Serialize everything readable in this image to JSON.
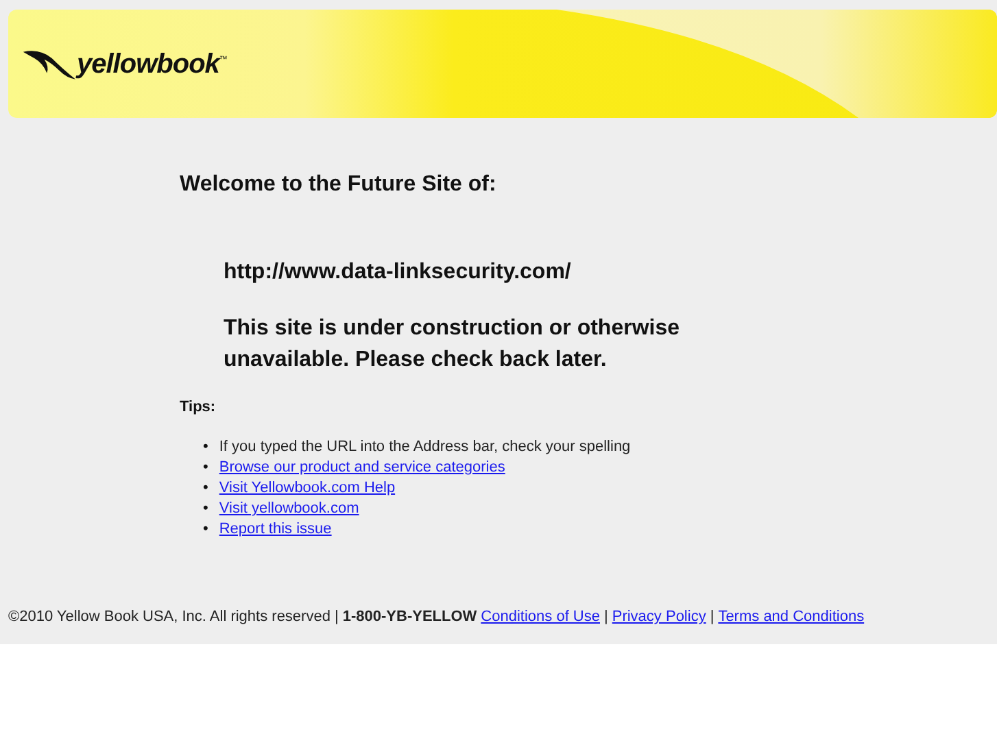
{
  "banner": {
    "logo_text": "yellowbook",
    "logo_mark": "™"
  },
  "heading": "Welcome to the Future Site of:",
  "url": "http://www.data-linksecurity.com/",
  "message": "This site is under construction or otherwise unavailable. Please check back later.",
  "tips": {
    "title": "Tips:",
    "items": [
      {
        "kind": "text",
        "marker": "•",
        "text": "If you typed the URL into the Address bar, check your spelling"
      },
      {
        "kind": "link",
        "marker": "•",
        "text": "Browse our product and service categories"
      },
      {
        "kind": "link",
        "marker": "•",
        "text": "Visit Yellowbook.com Help"
      },
      {
        "kind": "link",
        "marker": "•",
        "text": "Visit yellowbook.com"
      },
      {
        "kind": "link",
        "marker": "•",
        "text": "Report this issue"
      }
    ]
  },
  "footer": [
    {
      "kind": "text",
      "text": "©2010 Yellow Book USA, Inc. All rights reserved |"
    },
    {
      "kind": "bold",
      "text": "1-800-YB-YELLOW"
    },
    {
      "kind": "link",
      "text": "Conditions of Use"
    },
    {
      "kind": "text",
      "text": "|"
    },
    {
      "kind": "link",
      "text": "Privacy Policy"
    },
    {
      "kind": "text",
      "text": "|"
    },
    {
      "kind": "link",
      "text": "Terms and Conditions"
    }
  ]
}
